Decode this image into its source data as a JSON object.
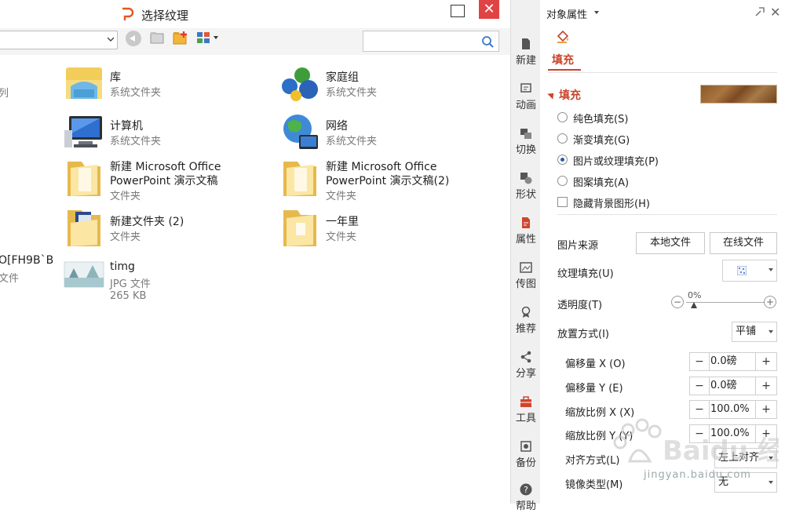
{
  "dialog": {
    "title": "选择纹理",
    "search": {
      "placeholder": ""
    },
    "files": [
      {
        "name": "库",
        "type": "系统文件夹",
        "icon": "library-icon"
      },
      {
        "name": "家庭组",
        "type": "系统文件夹",
        "icon": "homegroup-icon"
      },
      {
        "name": "计算机",
        "type": "系统文件夹",
        "icon": "computer-icon"
      },
      {
        "name": "网络",
        "type": "系统文件夹",
        "icon": "network-globe-icon"
      },
      {
        "name_line1": "新建 Microsoft Office",
        "name_line2": "PowerPoint 演示文稿",
        "type": "文件夹",
        "icon": "folder-icon"
      },
      {
        "name_line1": "新建 Microsoft Office",
        "name_line2": "PowerPoint 演示文稿(2)",
        "type": "文件夹",
        "icon": "folder-icon"
      },
      {
        "name": "新建文件夹 (2)",
        "type": "文件夹",
        "icon": "folder-with-docs-icon"
      },
      {
        "name": "一年里",
        "type": "文件夹",
        "icon": "folder-icon"
      },
      {
        "name": "timg",
        "type": "JPG 文件",
        "size": "265 KB",
        "icon": "jpg-thumbnail-icon"
      }
    ],
    "partial_left": {
      "item1": "列",
      "item2_name": "O[FH9B`B",
      "item2_type": "文件"
    }
  },
  "rail": {
    "items": [
      {
        "label": "新建",
        "icon": "new-doc-icon"
      },
      {
        "label": "动画",
        "icon": "animation-icon"
      },
      {
        "label": "切换",
        "icon": "transition-icon"
      },
      {
        "label": "形状",
        "icon": "shape-icon"
      },
      {
        "label": "属性",
        "icon": "properties-icon"
      },
      {
        "label": "传图",
        "icon": "upload-image-icon"
      },
      {
        "label": "推荐",
        "icon": "recommend-icon"
      },
      {
        "label": "分享",
        "icon": "share-icon"
      },
      {
        "label": "工具",
        "icon": "toolbox-icon"
      },
      {
        "label": "备份",
        "icon": "backup-icon"
      },
      {
        "label": "帮助",
        "icon": "help-icon"
      }
    ]
  },
  "panel": {
    "title": "对象属性",
    "tab": "填充",
    "section": "填充",
    "fill_options": [
      {
        "label": "纯色填充(S)",
        "selected": false
      },
      {
        "label": "渐变填充(G)",
        "selected": false
      },
      {
        "label": "图片或纹理填充(P)",
        "selected": true
      },
      {
        "label": "图案填充(A)",
        "selected": false
      }
    ],
    "hide_bg": "隐藏背景图形(H)",
    "image_source": {
      "label": "图片来源",
      "local": "本地文件",
      "online": "在线文件"
    },
    "texture": {
      "label": "纹理填充(U)"
    },
    "transparency": {
      "label": "透明度(T)",
      "value": "0%",
      "minus": "−",
      "plus": "+"
    },
    "placement": {
      "label": "放置方式(I)",
      "value": "平铺"
    },
    "offset_x": {
      "label": "偏移量 X (O)",
      "value": "0.0磅"
    },
    "offset_y": {
      "label": "偏移量 Y (E)",
      "value": "0.0磅"
    },
    "scale_x": {
      "label": "缩放比例 X (X)",
      "value": "100.0%"
    },
    "scale_y": {
      "label": "缩放比例 Y (Y)",
      "value": "100.0%"
    },
    "align": {
      "label": "对齐方式(L)",
      "value": "左上对齐"
    },
    "mirror": {
      "label": "镜像类型(M)",
      "value": "无"
    },
    "stepper_minus": "−",
    "stepper_plus": "+"
  },
  "watermark": {
    "text": "Baidu 经验",
    "url": "jingyan.baidu.com"
  }
}
